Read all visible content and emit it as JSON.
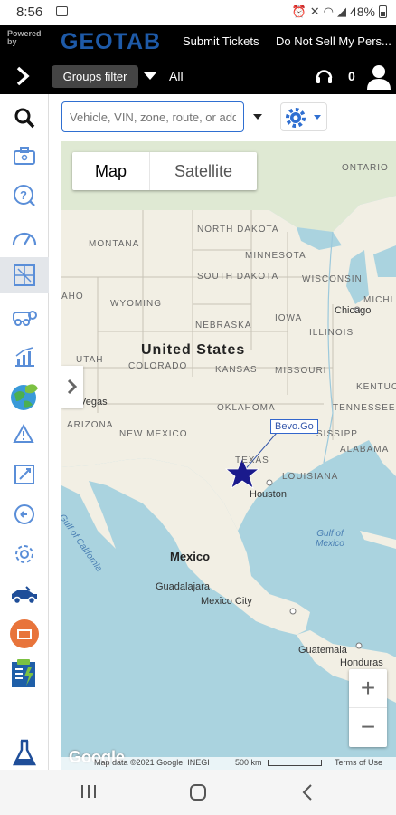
{
  "status_bar": {
    "time": "8:56",
    "battery": "48%"
  },
  "header": {
    "powered_by": "Powered by",
    "logo": "GEOTAB",
    "submit_tickets": "Submit Tickets",
    "do_not_sell": "Do Not Sell My Pers..."
  },
  "filter_bar": {
    "groups_filter": "Groups filter",
    "groups_value": "All",
    "notification_count": "0"
  },
  "search": {
    "placeholder": "Vehicle, VIN, zone, route, or address"
  },
  "sidebar": {
    "items": [
      {
        "name": "search-icon"
      },
      {
        "name": "briefcase-icon"
      },
      {
        "name": "help-icon"
      },
      {
        "name": "speedometer-icon"
      },
      {
        "name": "map-icon",
        "active": true
      },
      {
        "name": "vehicle-icon"
      },
      {
        "name": "activity-icon"
      },
      {
        "name": "sustainability-icon"
      },
      {
        "name": "exceptions-icon"
      },
      {
        "name": "rules-icon"
      },
      {
        "name": "history-icon"
      },
      {
        "name": "settings-icon"
      },
      {
        "name": "fleet-icon"
      },
      {
        "name": "marketplace-icon"
      },
      {
        "name": "checklist-icon"
      },
      {
        "name": "labs-icon"
      }
    ]
  },
  "map": {
    "map_type": {
      "map": "Map",
      "satellite": "Satellite"
    },
    "labels": {
      "ontario": "ONTARIO",
      "north_dakota": "NORTH DAKOTA",
      "montana": "MONTANA",
      "minnesota": "MINNESOTA",
      "south_dakota": "SOUTH DAKOTA",
      "wisconsin": "WISCONSIN",
      "idaho": "AHO",
      "wyoming": "WYOMING",
      "michigan": "MICHI",
      "chicago": "Chicago",
      "nebraska": "NEBRASKA",
      "iowa": "IOWA",
      "united_states": "United States",
      "illinois": "ILLINOIS",
      "utah": "UTAH",
      "colorado": "COLORADO",
      "kansas": "KANSAS",
      "missouri": "MISSOURI",
      "kentucky": "KENTUC",
      "vegas": "Vegas",
      "oklahoma": "OKLAHOMA",
      "tennessee": "TENNESSEE",
      "arizona": "ARIZONA",
      "new_mexico": "NEW MEXICO",
      "mississippi": "SISSIPP",
      "alabama": "ALABAMA",
      "texas": "TEXAS",
      "louisiana": "LOUISIANA",
      "houston": "Houston",
      "gulf_california": "Gulf of California",
      "gulf_mexico": "Gulf of Mexico",
      "mexico": "Mexico",
      "guadalajara": "Guadalajara",
      "mexico_city": "Mexico City",
      "guatemala": "Guatemala",
      "honduras": "Honduras"
    },
    "vehicle_label": "Bevo.Go",
    "zoom_in": "+",
    "zoom_out": "−",
    "google": "Google",
    "attribution": "Map data ©2021 Google, INEGI",
    "scale": "500 km",
    "terms": "Terms of Use"
  },
  "colors": {
    "accent": "#2f6fd1",
    "header_bg": "#000000",
    "water": "#aad3df",
    "land": "#f2efe4",
    "vehicle_star": "#1a1a8c"
  }
}
